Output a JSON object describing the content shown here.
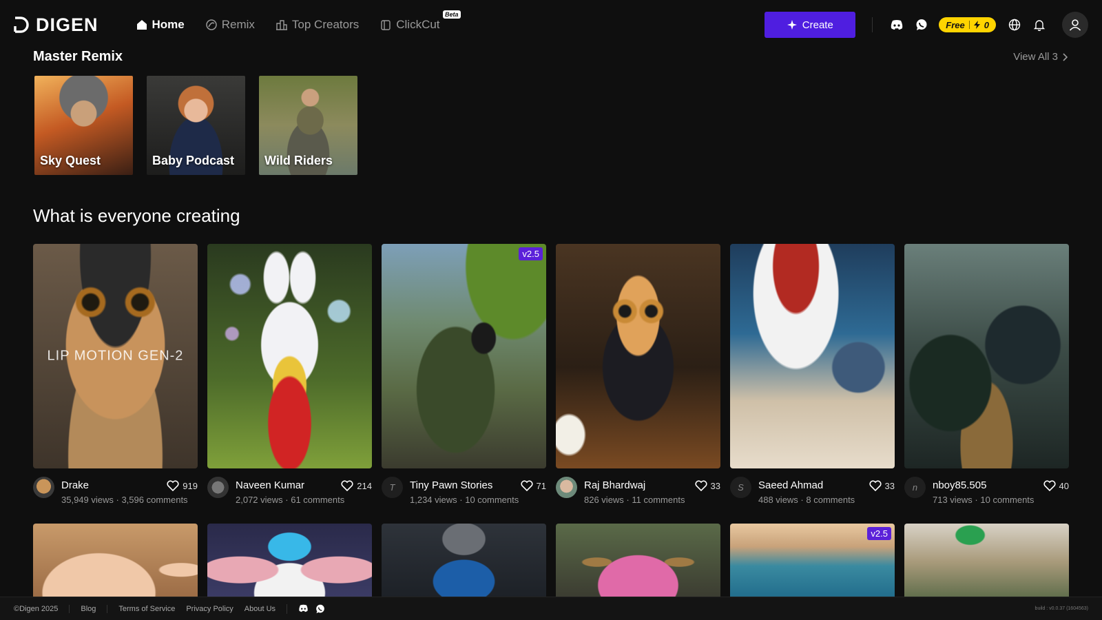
{
  "brand": {
    "name": "DIGEN"
  },
  "nav": [
    {
      "label": "Home",
      "icon": "home-icon",
      "active": true
    },
    {
      "label": "Remix",
      "icon": "remix-icon",
      "active": false
    },
    {
      "label": "Top Creators",
      "icon": "buildings-icon",
      "active": false
    },
    {
      "label": "ClickCut",
      "icon": "clickcut-icon",
      "active": false,
      "badge": "Beta"
    }
  ],
  "header": {
    "create_label": "Create",
    "credits": {
      "plan": "Free",
      "count": "0"
    },
    "colors": {
      "accent": "#4f1ee0",
      "credits_bg": "#ffd400"
    }
  },
  "master_remix": {
    "title": "Master Remix",
    "view_all": "View All 3",
    "items": [
      {
        "label": "Sky Quest"
      },
      {
        "label": "Baby Podcast"
      },
      {
        "label": "Wild Riders"
      }
    ]
  },
  "feed": {
    "title": "What is everyone creating",
    "cards": [
      {
        "overlay": "LIP MOTION GEN-2",
        "badge": "",
        "creator": "Drake",
        "avatar": "",
        "views": "35,949 views",
        "comments": "3,596 comments",
        "likes": "919"
      },
      {
        "overlay": "",
        "badge": "",
        "creator": "Naveen Kumar",
        "avatar": "",
        "views": "2,072 views",
        "comments": "61 comments",
        "likes": "214"
      },
      {
        "overlay": "",
        "badge": "v2.5",
        "creator": "Tiny Pawn Stories",
        "avatar": "T",
        "views": "1,234 views",
        "comments": "10 comments",
        "likes": "71"
      },
      {
        "overlay": "",
        "badge": "",
        "creator": "Raj Bhardwaj",
        "avatar": "",
        "views": "826 views",
        "comments": "11 comments",
        "likes": "33"
      },
      {
        "overlay": "",
        "badge": "",
        "creator": "Saeed Ahmad",
        "avatar": "S",
        "views": "488 views",
        "comments": "8 comments",
        "likes": "33"
      },
      {
        "overlay": "",
        "badge": "",
        "creator": "nboy85.505",
        "avatar": "n",
        "views": "713 views",
        "comments": "10 comments",
        "likes": "40"
      }
    ],
    "row2_badges": [
      "",
      "",
      "",
      "",
      "v2.5",
      ""
    ]
  },
  "footer": {
    "copyright": "©Digen 2025",
    "links": [
      "Blog",
      "Terms of Service",
      "Privacy Policy",
      "About Us"
    ],
    "build": "build : v0.0.37 (1604563)"
  }
}
